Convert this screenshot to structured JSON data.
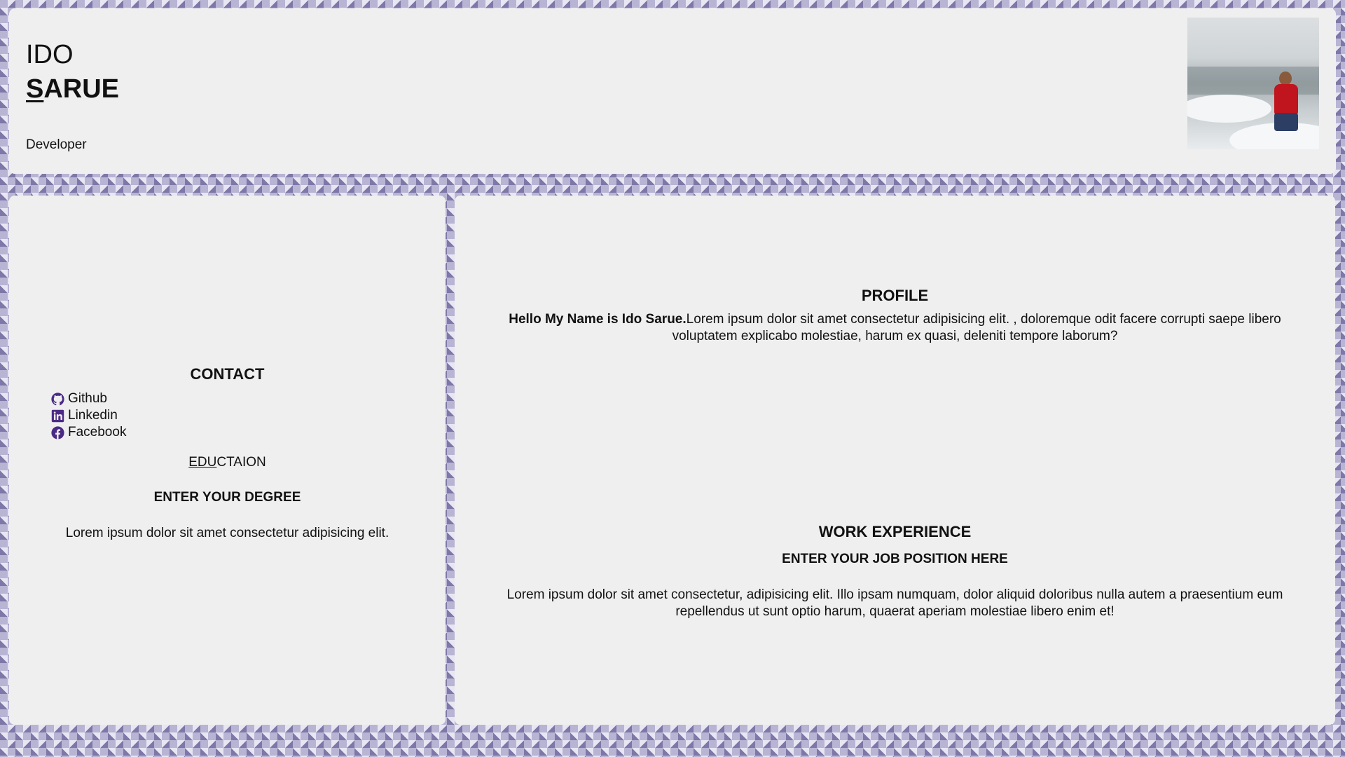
{
  "header": {
    "first_name": "IDO",
    "last_name_first_letter": "S",
    "last_name_rest": "ARUE",
    "role": "Developer"
  },
  "contact": {
    "title": "CONTACT",
    "links": [
      {
        "label": "Github",
        "icon": "github-icon"
      },
      {
        "label": "Linkedin",
        "icon": "linkedin-icon"
      },
      {
        "label": "Facebook",
        "icon": "facebook-icon"
      }
    ]
  },
  "education": {
    "title_underlined": "EDU",
    "title_rest": "CTAION",
    "degree": "ENTER YOUR DEGREE",
    "description": "Lorem ipsum dolor sit amet consectetur adipisicing elit."
  },
  "profile": {
    "title": "PROFILE",
    "intro_bold": "Hello My Name is Ido Sarue.",
    "text": "Lorem ipsum dolor sit amet consectetur adipisicing elit. , doloremque odit facere corrupti saepe libero voluptatem explicabo molestiae, harum ex quasi, deleniti tempore laborum?"
  },
  "work": {
    "title": "WORK EXPERIENCE",
    "job_title": "ENTER YOUR JOB POSITION HERE",
    "text": "Lorem ipsum dolor sit amet consectetur, adipisicing elit. Illo ipsam numquam, dolor aliquid doloribus nulla autem a praesentium eum repellendus ut sunt optio harum, quaerat aperiam molestiae libero enim et!"
  },
  "colors": {
    "icon": "#4b2a86",
    "panel": "#efefef"
  }
}
